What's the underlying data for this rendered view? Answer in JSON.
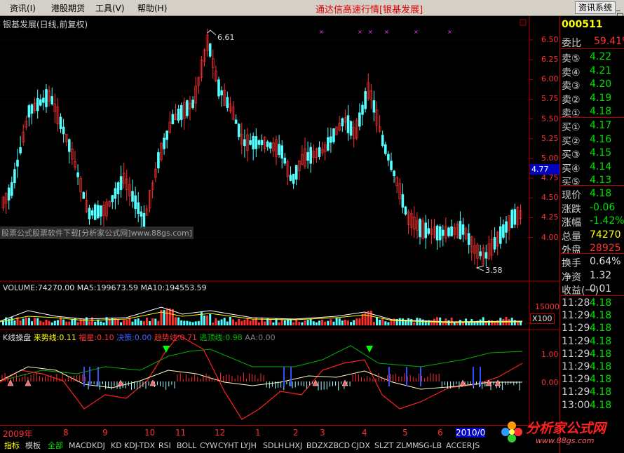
{
  "menubar": {
    "items": [
      "资讯(I)",
      "港股期货",
      "工具(V)",
      "帮助(H)"
    ],
    "title": "通达信高速行情[银基发展]",
    "news_button": "资讯系统",
    "window_buttons": "_ □ ×"
  },
  "main_chart": {
    "title": "银基发展(日线,前复权)",
    "high_label": "6.61",
    "low_label": "3.58",
    "current_price_tag": "4.77",
    "watermark": "股票公式股票软件下载[分析家公式网]www.88gs.com]",
    "y_ticks": [
      "6.50",
      "6.25",
      "6.00",
      "5.75",
      "5.50",
      "5.25",
      "5.00",
      "4.75",
      "4.50",
      "4.25",
      "4.00"
    ]
  },
  "volume_chart": {
    "header": "VOLUME:74270.00  MA5:199673.59  MA10:194553.59",
    "y_tick": "15000",
    "multiplier": "X100"
  },
  "indicator_chart": {
    "name": "K线操盘",
    "labels": [
      {
        "text": "来势线:0.11",
        "color": "#ffff00"
      },
      {
        "text": "福星:0.10",
        "color": "#ff3030"
      },
      {
        "text": "决策:0.00",
        "color": "#4060ff"
      },
      {
        "text": "趋势线:0.71",
        "color": "#ff3030"
      },
      {
        "text": "逃顶线:0.98",
        "color": "#00c000"
      },
      {
        "text": "AA:0.00",
        "color": "#808080"
      }
    ],
    "y_ticks": [
      "1.00",
      "0.00"
    ]
  },
  "date_axis": {
    "labels": [
      "2009年",
      "8",
      "9",
      "10",
      "11",
      "12",
      "1",
      "2",
      "3",
      "4",
      "5",
      "6",
      "2010/0"
    ]
  },
  "tabs": [
    "指标",
    "模板",
    "全部",
    "MACD",
    "KDJ",
    "KD",
    "KDJ-TDX",
    "RSI",
    "BOLL",
    "CYW",
    "CYHT",
    "LYJH",
    "SDLH",
    "LHXJ",
    "BDZX",
    "ZBCD",
    "CJDX",
    "SLZT",
    "ZLMM",
    "SG-LB",
    "ACCER",
    "JS"
  ],
  "side_panel": {
    "code": "000511",
    "weibi_label": "委比",
    "weibi_value": "59.41%",
    "asks": [
      {
        "label": "卖⑤",
        "price": "4.22"
      },
      {
        "label": "卖④",
        "price": "4.21"
      },
      {
        "label": "卖③",
        "price": "4.20"
      },
      {
        "label": "卖②",
        "price": "4.19"
      },
      {
        "label": "卖①",
        "price": "4.18"
      }
    ],
    "bids": [
      {
        "label": "买①",
        "price": "4.17"
      },
      {
        "label": "买②",
        "price": "4.16"
      },
      {
        "label": "买③",
        "price": "4.15"
      },
      {
        "label": "买④",
        "price": "4.14"
      },
      {
        "label": "买⑤",
        "price": "4.13"
      }
    ],
    "stats": [
      {
        "label": "现价",
        "value": "4.18",
        "color": "green"
      },
      {
        "label": "涨跌",
        "value": "-0.06",
        "color": "green"
      },
      {
        "label": "涨幅",
        "value": "-1.42%",
        "color": "green"
      },
      {
        "label": "总量",
        "value": "74270",
        "color": "yellow"
      },
      {
        "label": "外盘",
        "value": "28925",
        "color": "red"
      }
    ],
    "stats2": [
      {
        "label": "换手",
        "value": "0.64%",
        "color": "white"
      },
      {
        "label": "净资",
        "value": "1.32",
        "color": "white"
      },
      {
        "label": "收益(一)",
        "value": "0.01",
        "color": "white"
      }
    ],
    "ticks": [
      {
        "time": "11:28",
        "price": "4.18"
      },
      {
        "time": "11:29",
        "price": "4.18"
      },
      {
        "time": "11:29",
        "price": "4.18"
      },
      {
        "time": "11:29",
        "price": "4.18"
      },
      {
        "time": "11:29",
        "price": "4.18"
      },
      {
        "time": "11:29",
        "price": "4.18"
      },
      {
        "time": "11:29",
        "price": "4.18"
      },
      {
        "time": "11:29",
        "price": "4.18"
      },
      {
        "time": "13:00",
        "price": "4.18"
      }
    ]
  },
  "brand": {
    "name": "分析家公式网",
    "url": "www.88gs.com"
  }
}
